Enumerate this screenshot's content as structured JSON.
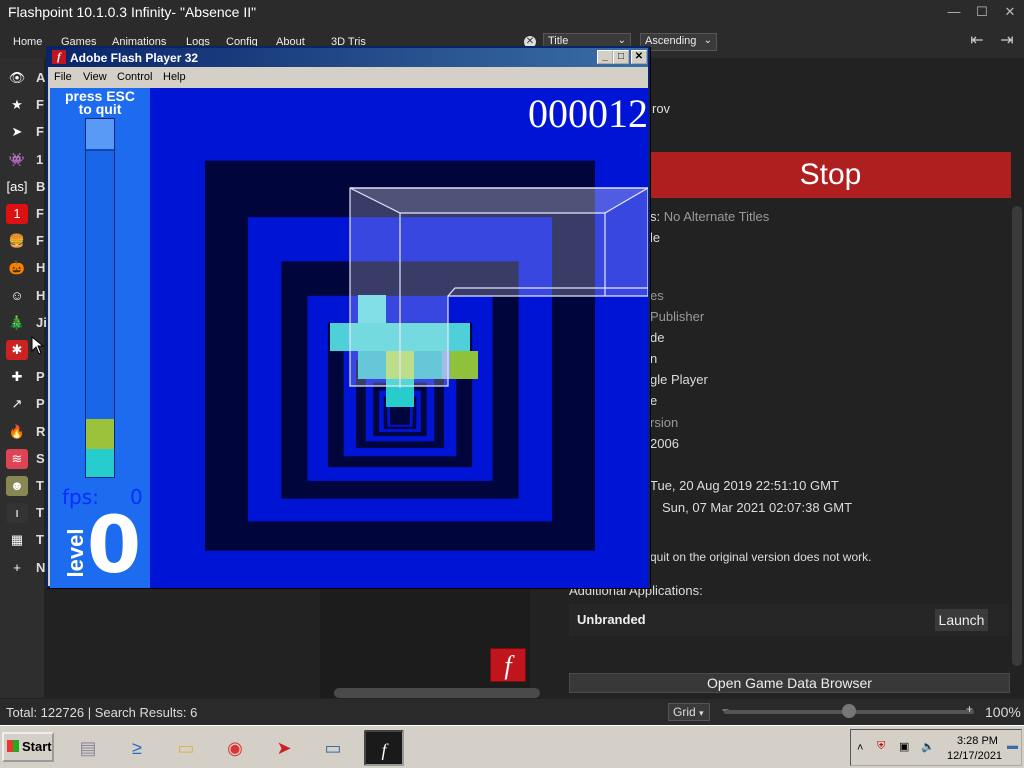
{
  "window": {
    "title": "Flashpoint 10.1.0.3 Infinity- \"Absence II\"",
    "minimize": "—",
    "maximize": "☐",
    "close": "✕"
  },
  "menu": [
    "Home",
    "Games",
    "Animations",
    "Logs",
    "Config",
    "About"
  ],
  "search": {
    "value": "3D Tris",
    "clear": "✕"
  },
  "sort": {
    "field": "Title",
    "order": "Ascending",
    "chevron": "⌄"
  },
  "sidebar": {
    "items": [
      {
        "label": "A",
        "icon": "eye-icon",
        "color": "#2e2e2e",
        "glyph": "👁"
      },
      {
        "label": "F",
        "icon": "star-icon",
        "color": "#2e2e2e",
        "glyph": "★"
      },
      {
        "label": "F",
        "icon": "flashpoint-icon",
        "color": "#2e2e2e",
        "glyph": "➤"
      },
      {
        "label": "1",
        "icon": "space-invader-icon",
        "color": "#2e2e2e",
        "glyph": "👾"
      },
      {
        "label": "B",
        "icon": "as-icon",
        "color": "#2e2e2e",
        "glyph": "[as]"
      },
      {
        "label": "F",
        "icon": "number-one-icon",
        "color": "#d11",
        "glyph": "1"
      },
      {
        "label": "F",
        "icon": "burger-icon",
        "color": "#2e2e2e",
        "glyph": "🍔"
      },
      {
        "label": "H",
        "icon": "pumpkin-icon",
        "color": "#2e2e2e",
        "glyph": "🎃"
      },
      {
        "label": "H",
        "icon": "face-icon",
        "color": "#2e2e2e",
        "glyph": "☺"
      },
      {
        "label": "Ji",
        "icon": "tree-icon",
        "color": "#2e2e2e",
        "glyph": "🎄"
      },
      {
        "label": "",
        "icon": "noise-icon",
        "color": "#c22",
        "glyph": "✱"
      },
      {
        "label": "P",
        "icon": "pixel-icon",
        "color": "#2e2e2e",
        "glyph": "✚"
      },
      {
        "label": "P",
        "icon": "share-icon",
        "color": "#2e2e2e",
        "glyph": "↗"
      },
      {
        "label": "R",
        "icon": "fire-icon",
        "color": "#2e2e2e",
        "glyph": "🔥"
      },
      {
        "label": "S",
        "icon": "wave-icon",
        "color": "#d45",
        "glyph": "≋"
      },
      {
        "label": "T",
        "icon": "girl-icon",
        "color": "#885",
        "glyph": "☻"
      },
      {
        "label": "T",
        "icon": "figure-icon",
        "color": "#333",
        "glyph": "ı"
      },
      {
        "label": "T",
        "icon": "cubes-icon",
        "color": "#2e2e2e",
        "glyph": "▦"
      },
      {
        "label": "N",
        "icon": "plus-icon",
        "color": "#2e2e2e",
        "glyph": "+"
      }
    ]
  },
  "details": {
    "author_tail": "rov",
    "stop_label": "Stop",
    "lines": [
      {
        "text": "s: ",
        "dim": "No Alternate Titles"
      },
      {
        "text": "le",
        "dim": ""
      },
      {
        "text": "",
        "dim": "es"
      },
      {
        "text": "",
        "dim": "Publisher"
      },
      {
        "text": "de",
        "dim": ""
      },
      {
        "text": "n",
        "dim": ""
      },
      {
        "text": "gle Player",
        "dim": ""
      },
      {
        "text": "e",
        "dim": ""
      },
      {
        "text": "",
        "dim": "rsion"
      },
      {
        "text": "2006",
        "dim": ""
      },
      {
        "text": "Tue, 20 Aug 2019 22:51:10 GMT",
        "dim": ""
      },
      {
        "text": "Sun, 07 Mar 2021 02:07:38 GMT",
        "dim": ""
      },
      {
        "text": "quit on the original version does not work.",
        "dim": ""
      }
    ],
    "additional_apps_label": "Additional Applications:",
    "app_name": "Unbranded",
    "launch_label": "Launch",
    "open_data_browser": "Open Game Data Browser"
  },
  "status": {
    "total": "Total: 122726",
    "sep": "|",
    "results": "Search Results: 6",
    "view": "Grid",
    "zoom": "100%",
    "zoom_level": 0.5
  },
  "taskbar": {
    "start": "Start",
    "apps": [
      {
        "name": "server-icon",
        "glyph": "▤",
        "color": "#889"
      },
      {
        "name": "powershell-icon",
        "glyph": "≥",
        "color": "#2a6ac0"
      },
      {
        "name": "folder-icon",
        "glyph": "▭",
        "color": "#d9b64a"
      },
      {
        "name": "chrome-icon",
        "glyph": "◉",
        "color": "#d33"
      },
      {
        "name": "flashpoint-icon",
        "glyph": "➤",
        "color": "#c22"
      },
      {
        "name": "window-icon",
        "glyph": "▭",
        "color": "#3a6ea5"
      },
      {
        "name": "flash-player-icon",
        "glyph": "f",
        "color": "#b0141a"
      }
    ],
    "time": "3:28 PM",
    "date": "12/17/2021"
  },
  "flash": {
    "title": "Adobe Flash Player 32",
    "menu": [
      "File",
      "View",
      "Control",
      "Help"
    ],
    "press_esc": "press ESC",
    "to_quit": "to quit",
    "score": "000012",
    "fps_label": "fps:",
    "fps_value": "0",
    "level_label": "level",
    "level_value": "0"
  }
}
